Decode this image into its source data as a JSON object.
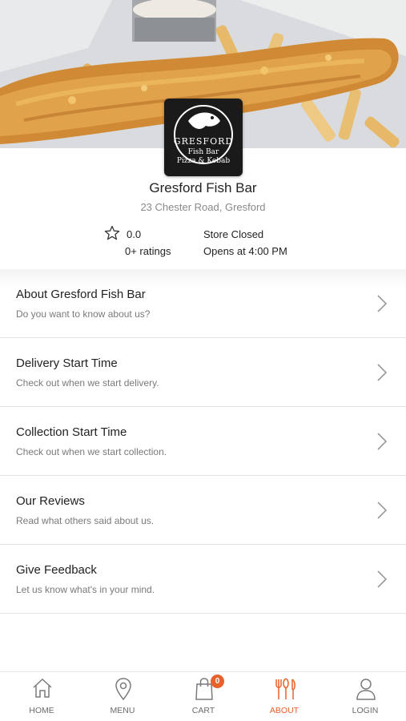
{
  "store": {
    "logo": {
      "line1": "GRESFORD",
      "line2": "Fish Bar",
      "line3": "Pizza & Kebab"
    },
    "name": "Gresford Fish Bar",
    "address": "23 Chester Road, Gresford",
    "rating": "0.0",
    "ratings_count": "0+ ratings",
    "status": "Store Closed",
    "opens_at": "Opens at 4:00 PM"
  },
  "menu": [
    {
      "title": "About Gresford Fish Bar",
      "subtitle": "Do you want to know about us?"
    },
    {
      "title": "Delivery Start Time",
      "subtitle": "Check out when we start delivery."
    },
    {
      "title": "Collection Start Time",
      "subtitle": "Check out when we start collection."
    },
    {
      "title": "Our Reviews",
      "subtitle": "Read what others said about us."
    },
    {
      "title": "Give Feedback",
      "subtitle": "Let us know what's in your mind."
    }
  ],
  "tabs": [
    {
      "label": "HOME",
      "icon": "home-icon"
    },
    {
      "label": "MENU",
      "icon": "location-pin-icon"
    },
    {
      "label": "CART",
      "icon": "shopping-bag-icon",
      "badge": "0"
    },
    {
      "label": "ABOUT",
      "icon": "fork-knife-icon",
      "active": true
    },
    {
      "label": "LOGIN",
      "icon": "user-icon"
    }
  ],
  "colors": {
    "accent": "#e8602c",
    "divider": "#e3e3e3",
    "subtitle": "#7a7a7a"
  }
}
